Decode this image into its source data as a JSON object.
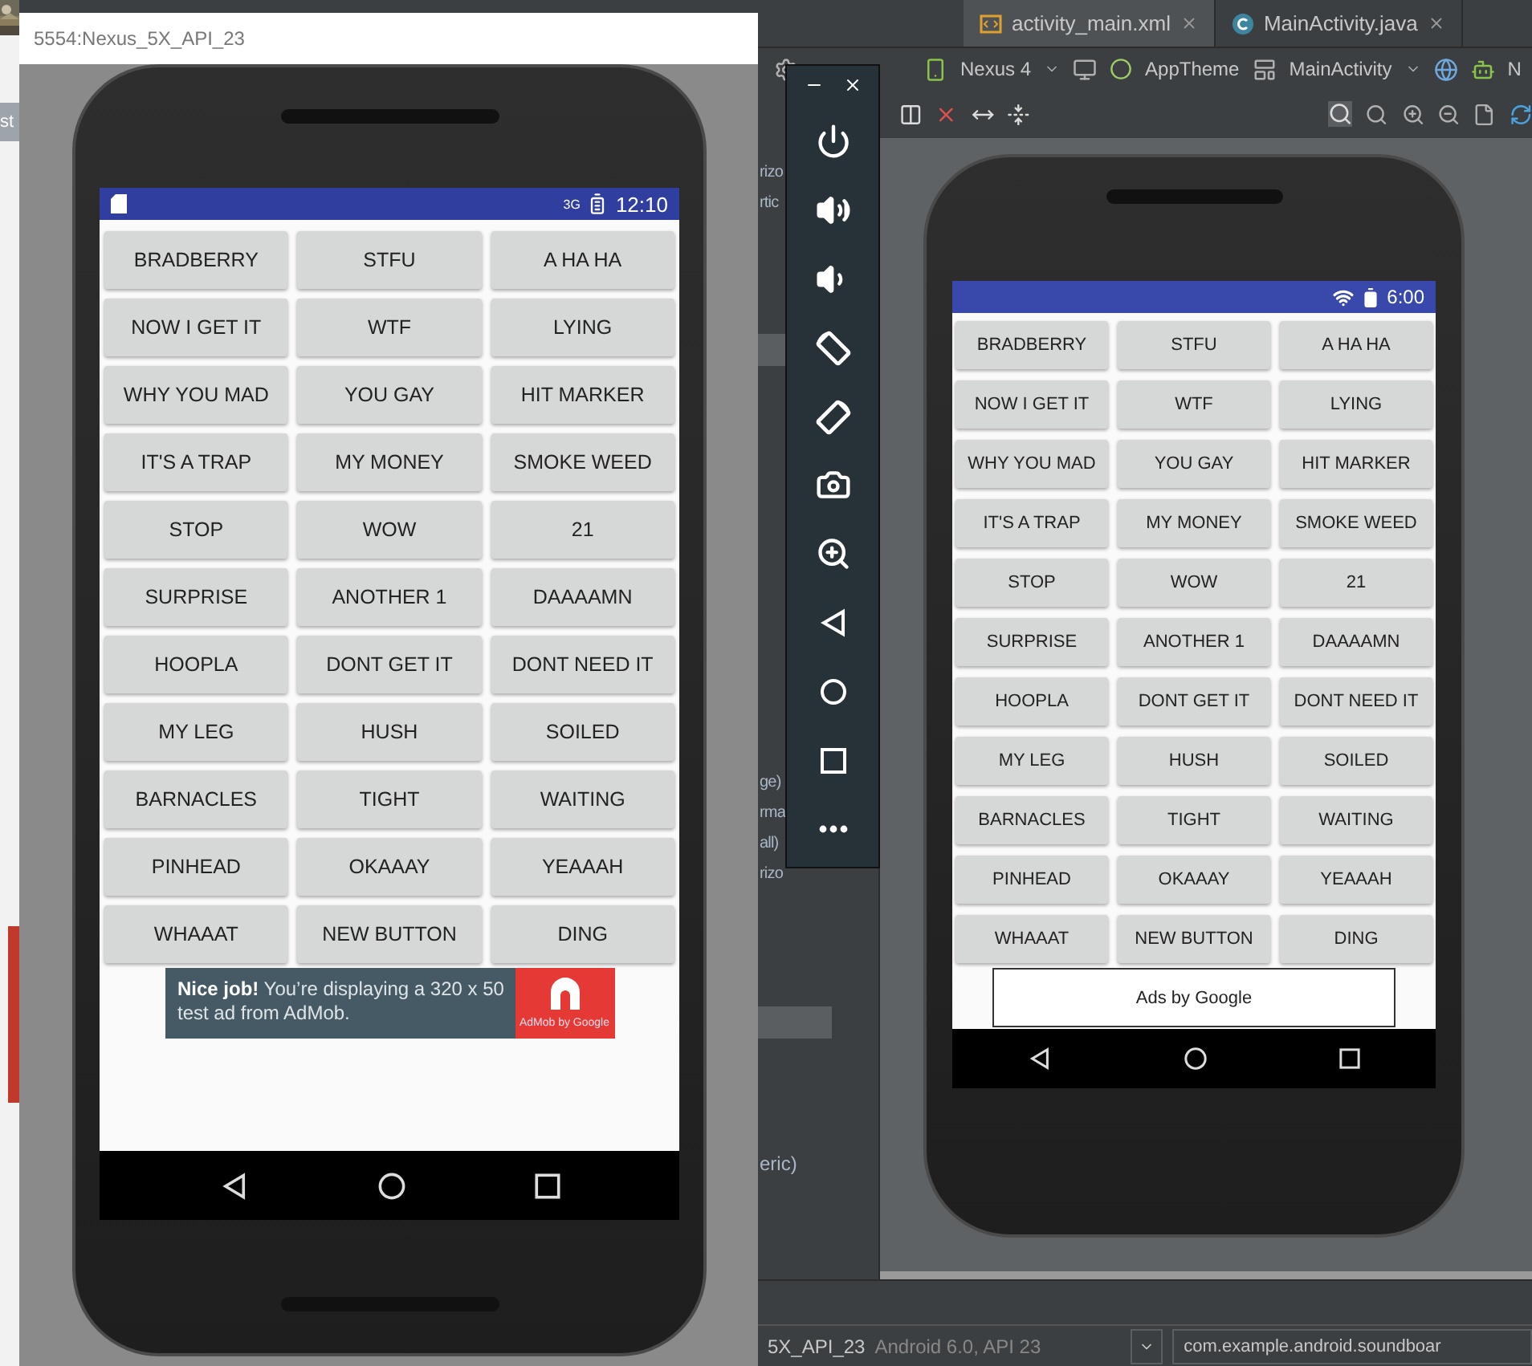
{
  "background_window": {
    "fragment": "st"
  },
  "emulator_window": {
    "title": "5554:Nexus_5X_API_23",
    "device": {
      "status_bar": {
        "network": "3G",
        "time": "12:10"
      },
      "buttons": [
        "BRADBERRY",
        "STFU",
        "A HA HA",
        "NOW I GET IT",
        "WTF",
        "LYING",
        "WHY YOU MAD",
        "YOU GAY",
        "HIT MARKER",
        "IT'S A TRAP",
        "MY MONEY",
        "SMOKE WEED",
        "STOP",
        "WOW",
        "21",
        "SURPRISE",
        "ANOTHER 1",
        "DAAAAMN",
        "HOOPLA",
        "DONT GET IT",
        "DONT NEED IT",
        "MY LEG",
        "HUSH",
        "SOILED",
        "BARNACLES",
        "TIGHT",
        "WAITING",
        "PINHEAD",
        "OKAAAY",
        "YEAAAH",
        "WHAAAT",
        "NEW BUTTON",
        "DING"
      ],
      "ad": {
        "text": "**Nice job!** You’re displaying a 320 x 50 test ad from AdMob.",
        "brand": "AdMob by Google"
      }
    }
  },
  "emulator_controls": [
    {
      "kind": "power"
    },
    {
      "kind": "volume-up"
    },
    {
      "kind": "volume-down"
    },
    {
      "kind": "rotate-left"
    },
    {
      "kind": "rotate-right"
    },
    {
      "kind": "camera"
    },
    {
      "kind": "zoom"
    },
    {
      "kind": "back"
    },
    {
      "kind": "home"
    },
    {
      "kind": "overview"
    },
    {
      "kind": "more"
    }
  ],
  "editor": {
    "tabs": [
      {
        "label": "activity_main.xml",
        "selected": true
      },
      {
        "label": "MainActivity.java",
        "selected": false
      }
    ],
    "toolbar": {
      "device": "Nexus 4",
      "theme": "AppTheme",
      "activity": "MainActivity",
      "api": "N"
    },
    "side_panel_fragments": [
      "rizo",
      "rtic",
      "ge)",
      "rma",
      "all)",
      "rizo",
      "eric)"
    ],
    "preview": {
      "status_bar": {
        "time": "6:00"
      },
      "buttons": [
        "BRADBERRY",
        "STFU",
        "A HA HA",
        "NOW I GET IT",
        "WTF",
        "LYING",
        "WHY YOU MAD",
        "YOU GAY",
        "HIT MARKER",
        "IT'S A TRAP",
        "MY MONEY",
        "SMOKE WEED",
        "STOP",
        "WOW",
        "21",
        "SURPRISE",
        "ANOTHER 1",
        "DAAAAMN",
        "HOOPLA",
        "DONT GET IT",
        "DONT NEED IT",
        "MY LEG",
        "HUSH",
        "SOILED",
        "BARNACLES",
        "TIGHT",
        "WAITING",
        "PINHEAD",
        "OKAAAY",
        "YEAAAH",
        "WHAAAT",
        "NEW BUTTON",
        "DING"
      ],
      "ad_label": "Ads by Google"
    },
    "run_bar": {
      "device": "5X_API_23",
      "device_detail": "Android 6.0, API 23",
      "module": "com.example.android.soundboar"
    }
  }
}
